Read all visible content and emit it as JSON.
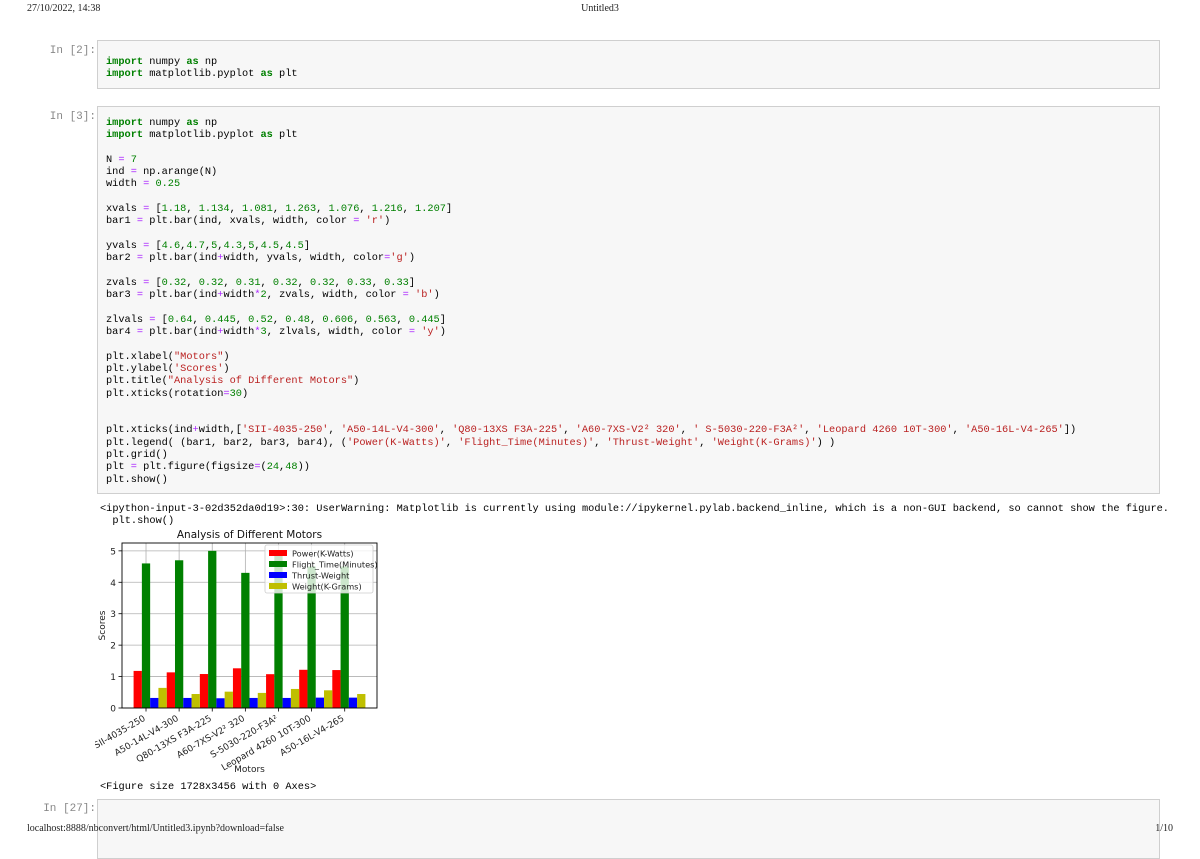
{
  "header": {
    "datetime": "27/10/2022, 14:38",
    "title": "Untitled3"
  },
  "footer": {
    "url": "localhost:8888/nbconvert/html/Untitled3.ipynb?download=false",
    "page": "1/10"
  },
  "cells": [
    {
      "prompt": "In [2]:",
      "lines": [
        [
          [
            "k",
            "import"
          ],
          [
            "p",
            " numpy "
          ],
          [
            "k",
            "as"
          ],
          [
            "p",
            " np"
          ]
        ],
        [
          [
            "k",
            "import"
          ],
          [
            "p",
            " matplotlib.pyplot "
          ],
          [
            "k",
            "as"
          ],
          [
            "p",
            " plt"
          ]
        ]
      ]
    },
    {
      "prompt": "In [3]:",
      "lines": [
        [
          [
            "k",
            "import"
          ],
          [
            "p",
            " numpy "
          ],
          [
            "k",
            "as"
          ],
          [
            "p",
            " np"
          ]
        ],
        [
          [
            "k",
            "import"
          ],
          [
            "p",
            " matplotlib.pyplot "
          ],
          [
            "k",
            "as"
          ],
          [
            "p",
            " plt"
          ]
        ],
        [],
        [
          [
            "p",
            "N "
          ],
          [
            "o",
            "="
          ],
          [
            "p",
            " "
          ],
          [
            "n",
            "7"
          ]
        ],
        [
          [
            "p",
            "ind "
          ],
          [
            "o",
            "="
          ],
          [
            "p",
            " np.arange(N)"
          ]
        ],
        [
          [
            "p",
            "width "
          ],
          [
            "o",
            "="
          ],
          [
            "p",
            " "
          ],
          [
            "n",
            "0.25"
          ]
        ],
        [],
        [
          [
            "p",
            "xvals "
          ],
          [
            "o",
            "="
          ],
          [
            "p",
            " ["
          ],
          [
            "n",
            "1.18"
          ],
          [
            "p",
            ", "
          ],
          [
            "n",
            "1.134"
          ],
          [
            "p",
            ", "
          ],
          [
            "n",
            "1.081"
          ],
          [
            "p",
            ", "
          ],
          [
            "n",
            "1.263"
          ],
          [
            "p",
            ", "
          ],
          [
            "n",
            "1.076"
          ],
          [
            "p",
            ", "
          ],
          [
            "n",
            "1.216"
          ],
          [
            "p",
            ", "
          ],
          [
            "n",
            "1.207"
          ],
          [
            "p",
            "]"
          ]
        ],
        [
          [
            "p",
            "bar1 "
          ],
          [
            "o",
            "="
          ],
          [
            "p",
            " plt.bar(ind, xvals, width, color "
          ],
          [
            "o",
            "="
          ],
          [
            "p",
            " "
          ],
          [
            "s",
            "'r'"
          ],
          [
            "p",
            ")"
          ]
        ],
        [],
        [
          [
            "p",
            "yvals "
          ],
          [
            "o",
            "="
          ],
          [
            "p",
            " ["
          ],
          [
            "n",
            "4.6"
          ],
          [
            "p",
            ","
          ],
          [
            "n",
            "4.7"
          ],
          [
            "p",
            ","
          ],
          [
            "n",
            "5"
          ],
          [
            "p",
            ","
          ],
          [
            "n",
            "4.3"
          ],
          [
            "p",
            ","
          ],
          [
            "n",
            "5"
          ],
          [
            "p",
            ","
          ],
          [
            "n",
            "4.5"
          ],
          [
            "p",
            ","
          ],
          [
            "n",
            "4.5"
          ],
          [
            "p",
            "]"
          ]
        ],
        [
          [
            "p",
            "bar2 "
          ],
          [
            "o",
            "="
          ],
          [
            "p",
            " plt.bar(ind"
          ],
          [
            "o",
            "+"
          ],
          [
            "p",
            "width, yvals, width, color"
          ],
          [
            "o",
            "="
          ],
          [
            "s",
            "'g'"
          ],
          [
            "p",
            ")"
          ]
        ],
        [],
        [
          [
            "p",
            "zvals "
          ],
          [
            "o",
            "="
          ],
          [
            "p",
            " ["
          ],
          [
            "n",
            "0.32"
          ],
          [
            "p",
            ", "
          ],
          [
            "n",
            "0.32"
          ],
          [
            "p",
            ", "
          ],
          [
            "n",
            "0.31"
          ],
          [
            "p",
            ", "
          ],
          [
            "n",
            "0.32"
          ],
          [
            "p",
            ", "
          ],
          [
            "n",
            "0.32"
          ],
          [
            "p",
            ", "
          ],
          [
            "n",
            "0.33"
          ],
          [
            "p",
            ", "
          ],
          [
            "n",
            "0.33"
          ],
          [
            "p",
            "]"
          ]
        ],
        [
          [
            "p",
            "bar3 "
          ],
          [
            "o",
            "="
          ],
          [
            "p",
            " plt.bar(ind"
          ],
          [
            "o",
            "+"
          ],
          [
            "p",
            "width"
          ],
          [
            "o",
            "*"
          ],
          [
            "n",
            "2"
          ],
          [
            "p",
            ", zvals, width, color "
          ],
          [
            "o",
            "="
          ],
          [
            "p",
            " "
          ],
          [
            "s",
            "'b'"
          ],
          [
            "p",
            ")"
          ]
        ],
        [],
        [
          [
            "p",
            "zlvals "
          ],
          [
            "o",
            "="
          ],
          [
            "p",
            " ["
          ],
          [
            "n",
            "0.64"
          ],
          [
            "p",
            ", "
          ],
          [
            "n",
            "0.445"
          ],
          [
            "p",
            ", "
          ],
          [
            "n",
            "0.52"
          ],
          [
            "p",
            ", "
          ],
          [
            "n",
            "0.48"
          ],
          [
            "p",
            ", "
          ],
          [
            "n",
            "0.606"
          ],
          [
            "p",
            ", "
          ],
          [
            "n",
            "0.563"
          ],
          [
            "p",
            ", "
          ],
          [
            "n",
            "0.445"
          ],
          [
            "p",
            "]"
          ]
        ],
        [
          [
            "p",
            "bar4 "
          ],
          [
            "o",
            "="
          ],
          [
            "p",
            " plt.bar(ind"
          ],
          [
            "o",
            "+"
          ],
          [
            "p",
            "width"
          ],
          [
            "o",
            "*"
          ],
          [
            "n",
            "3"
          ],
          [
            "p",
            ", zlvals, width, color "
          ],
          [
            "o",
            "="
          ],
          [
            "p",
            " "
          ],
          [
            "s",
            "'y'"
          ],
          [
            "p",
            ")"
          ]
        ],
        [],
        [
          [
            "p",
            "plt.xlabel("
          ],
          [
            "s",
            "\"Motors\""
          ],
          [
            "p",
            ")"
          ]
        ],
        [
          [
            "p",
            "plt.ylabel("
          ],
          [
            "s",
            "'Scores'"
          ],
          [
            "p",
            ")"
          ]
        ],
        [
          [
            "p",
            "plt.title("
          ],
          [
            "s",
            "\"Analysis of Different Motors\""
          ],
          [
            "p",
            ")"
          ]
        ],
        [
          [
            "p",
            "plt.xticks(rotation"
          ],
          [
            "o",
            "="
          ],
          [
            "n",
            "30"
          ],
          [
            "p",
            ")"
          ]
        ],
        [],
        [],
        [
          [
            "p",
            "plt.xticks(ind"
          ],
          [
            "o",
            "+"
          ],
          [
            "p",
            "width,["
          ],
          [
            "s",
            "'SII-4035-250'"
          ],
          [
            "p",
            ", "
          ],
          [
            "s",
            "'A50-14L-V4-300'"
          ],
          [
            "p",
            ", "
          ],
          [
            "s",
            "'Q80-13XS F3A-225'"
          ],
          [
            "p",
            ", "
          ],
          [
            "s",
            "'A60-7XS-V2² 320'"
          ],
          [
            "p",
            ", "
          ],
          [
            "s",
            "' S-5030-220-F3A²'"
          ],
          [
            "p",
            ", "
          ],
          [
            "s",
            "'Leopard 4260 10T-300'"
          ],
          [
            "p",
            ", "
          ],
          [
            "s",
            "'A50-16L-V4-265'"
          ],
          [
            "p",
            "])"
          ]
        ],
        [
          [
            "p",
            "plt.legend( (bar1, bar2, bar3, bar4), ("
          ],
          [
            "s",
            "'Power(K-Watts)'"
          ],
          [
            "p",
            ", "
          ],
          [
            "s",
            "'Flight_Time(Minutes)'"
          ],
          [
            "p",
            ", "
          ],
          [
            "s",
            "'Thrust-Weight'"
          ],
          [
            "p",
            ", "
          ],
          [
            "s",
            "'Weight(K-Grams)'"
          ],
          [
            "p",
            ") )"
          ]
        ],
        [
          [
            "p",
            "plt.grid()"
          ]
        ],
        [
          [
            "p",
            "plt "
          ],
          [
            "o",
            "="
          ],
          [
            "p",
            " plt.figure(figsize"
          ],
          [
            "o",
            "="
          ],
          [
            "p",
            "("
          ],
          [
            "n",
            "24"
          ],
          [
            "p",
            ","
          ],
          [
            "n",
            "48"
          ],
          [
            "p",
            "))"
          ]
        ],
        [
          [
            "p",
            "plt.show()"
          ]
        ]
      ]
    },
    {
      "prompt": "In [27]:",
      "lines": []
    }
  ],
  "output": {
    "warning": "<ipython-input-3-02d352da0d19>:30: UserWarning: Matplotlib is currently using module://ipykernel.pylab.backend_inline, which is a non-GUI backend, so cannot show the figure.",
    "warning_line2": "  plt.show()",
    "figure_repr": "<Figure size 1728x3456 with 0 Axes>"
  },
  "chart_data": {
    "type": "bar",
    "title": "Analysis of Different Motors",
    "xlabel": "Motors",
    "ylabel": "Scores",
    "categories": [
      "SII-4035-250",
      "A50-14L-V4-300",
      "Q80-13XS F3A-225",
      "A60-7XS-V2² 320",
      " S-5030-220-F3A²",
      "Leopard 4260 10T-300",
      "A50-16L-V4-265"
    ],
    "series": [
      {
        "name": "Power(K-Watts)",
        "color": "#ff0000",
        "values": [
          1.18,
          1.134,
          1.081,
          1.263,
          1.076,
          1.216,
          1.207
        ]
      },
      {
        "name": "Flight_Time(Minutes)",
        "color": "#008000",
        "values": [
          4.6,
          4.7,
          5,
          4.3,
          5,
          4.5,
          4.5
        ]
      },
      {
        "name": "Thrust-Weight",
        "color": "#0000ff",
        "values": [
          0.32,
          0.32,
          0.31,
          0.32,
          0.32,
          0.33,
          0.33
        ]
      },
      {
        "name": "Weight(K-Grams)",
        "color": "#bfbf00",
        "values": [
          0.64,
          0.445,
          0.52,
          0.48,
          0.606,
          0.563,
          0.445
        ]
      }
    ],
    "bar_width": 0.25,
    "ylim": [
      0,
      5.25
    ],
    "xlim": [
      -0.475,
      7.225
    ],
    "yticks": [
      0,
      1,
      2,
      3,
      4,
      5
    ],
    "xtick_rotation": 30,
    "grid": true,
    "legend_placement": "top-right"
  }
}
